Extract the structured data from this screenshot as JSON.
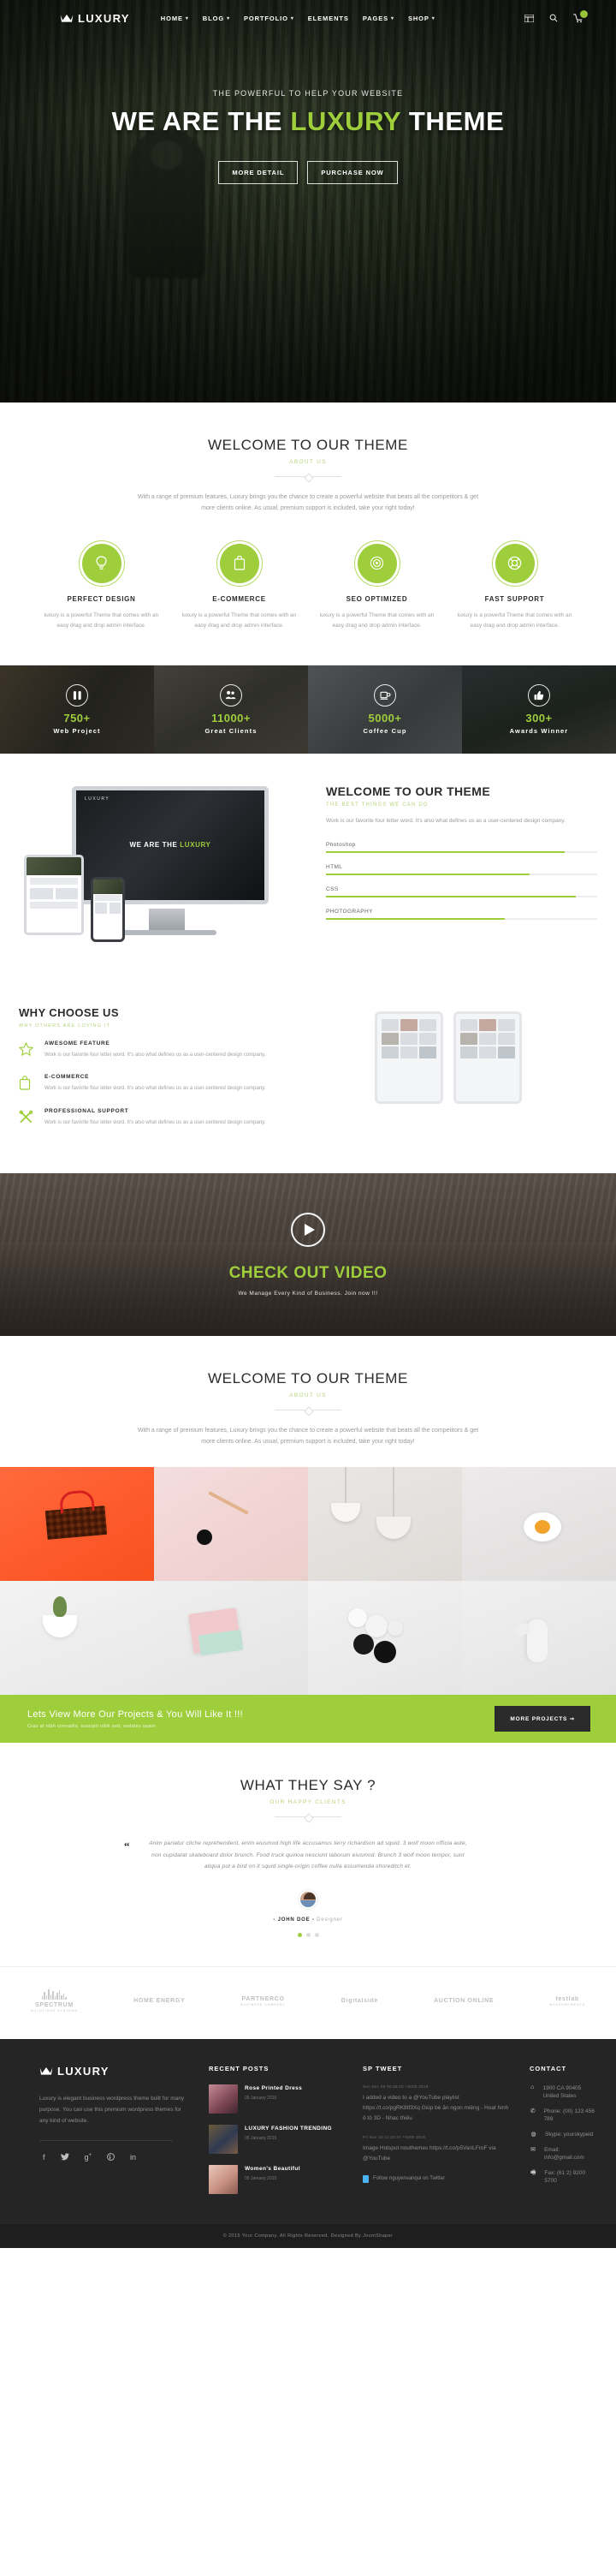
{
  "header": {
    "brand": "LUXURY",
    "nav": [
      {
        "label": "HOME",
        "caret": true
      },
      {
        "label": "BLOG",
        "caret": true
      },
      {
        "label": "PORTFOLIO",
        "caret": true
      },
      {
        "label": "ELEMENTS",
        "caret": false
      },
      {
        "label": "PAGES",
        "caret": true
      },
      {
        "label": "SHOP",
        "caret": true
      }
    ],
    "icons": [
      "grid-icon",
      "search-icon",
      "cart-icon"
    ]
  },
  "hero": {
    "kicker": "THE POWERFUL TO HELP YOUR WEBSITE",
    "title_pre": "WE ARE THE ",
    "title_accent": "LUXURY",
    "title_post": " THEME",
    "btn_primary": "MORE DETAIL",
    "btn_secondary": "PURCHASE NOW"
  },
  "welcome": {
    "title": "WELCOME TO OUR THEME",
    "subtitle": "ABOUT US",
    "description": "With a range of premium features, Luxury brings you the chance to create a powerful website that beats all the competitors & get more clients online. As usual, premium support is included, take your right today!"
  },
  "features": [
    {
      "icon": "lightbulb-icon",
      "title": "PERFECT DESIGN",
      "desc": "luxury is a powerful Theme that comes with an easy drag and drop admin interface."
    },
    {
      "icon": "bag-icon",
      "title": "E-COMMERCE",
      "desc": "luxury is a powerful Theme that comes with an easy drag and drop admin interface."
    },
    {
      "icon": "target-icon",
      "title": "SEO OPTIMIZED",
      "desc": "luxury is a powerful Theme that comes with an easy drag and drop admin interface."
    },
    {
      "icon": "lifebuoy-icon",
      "title": "FAST SUPPORT",
      "desc": "luxury is a powerful Theme that comes with an easy drag and drop admin interface."
    }
  ],
  "counters": [
    {
      "icon": "pen-icon",
      "number": "750+",
      "label": "Web Project"
    },
    {
      "icon": "users-icon",
      "number": "11000+",
      "label": "Great Clients"
    },
    {
      "icon": "coffee-icon",
      "number": "5000+",
      "label": "Coffee Cup"
    },
    {
      "icon": "thumbs-up-icon",
      "number": "300+",
      "label": "Awards Winner"
    }
  ],
  "showcase": {
    "monitor_brand": "LUXURY",
    "monitor_line_pre": "WE ARE THE ",
    "monitor_line_accent": "LUXURY",
    "title": "WELCOME TO OUR THEME",
    "subtitle": "THE BEST THINGS WE CAN DO",
    "description": "Work is our favorite four letter word. It's also what defines us as a user-centered design company.",
    "skills": [
      {
        "name": "Photoshop",
        "value": 88
      },
      {
        "name": "HTML",
        "value": 75
      },
      {
        "name": "CSS",
        "value": 92
      },
      {
        "name": "PHOTOGRAPHY",
        "value": 66
      }
    ]
  },
  "why": {
    "title": "WHY CHOOSE US",
    "subtitle": "WHY OTHERS ARE LOVING IT",
    "items": [
      {
        "icon": "star-icon",
        "title": "AWESOME FEATURE",
        "desc": "Work is our favorite four letter word. It's also what defines us as a user-centered design company."
      },
      {
        "icon": "bag-icon",
        "title": "E-COMMERCE",
        "desc": "Work is our favorite four letter word. It's also what defines us as a user-centered design company."
      },
      {
        "icon": "tools-icon",
        "title": "PROFESSIONAL SUPPORT",
        "desc": "Work is our favorite four letter word. It's also what defines us as a user-centered design company."
      }
    ]
  },
  "video": {
    "play_icon": "play-icon",
    "title": "CHECK OUT VIDEO",
    "subtitle": "We Manage Every Kind of Business. Join now !!!"
  },
  "portfolio": {
    "title": "WELCOME TO OUR THEME",
    "subtitle": "ABOUT US",
    "description": "With a range of premium features, Luxury brings you the chance to create a powerful website that beats all the competitors & get more clients online. As usual, premium support is included, take your right today!",
    "cta_title": "Lets View More Our Projects & You Will Like It !!!",
    "cta_sub": "Cras at nibh convallis, suscipit nibh sed, sodales quam",
    "cta_button": "MORE PROJECTS ➞"
  },
  "testimonial": {
    "title": "WHAT THEY SAY ?",
    "subtitle": "OUR HAPPY CLIENTS",
    "quote_mark": "“",
    "quote": "Anim pariatur cliche reprehenderit, enim eiusmod high life accusamus terry richardson ad squid. 3 wolf moon officia aute, non cupidatat skateboard dolor brunch. Food truck quinoa nesciunt laborum eiusmod. Brunch 3 wolf moon tempor, sunt aliqua put a bird on it squid single-origin coffee nulla assumenda shoreditch et.",
    "author": "- JOHN DOE -",
    "role": "Designer",
    "dots": 3,
    "active_dot": 0
  },
  "clients": [
    {
      "name": "SPECTRUM",
      "tag": "SOLUTIONS SYSTEMS"
    },
    {
      "name": "HOME ENERGY",
      "tag": ""
    },
    {
      "name": "PARTNERCO",
      "tag": "BUSINESS COMPANY"
    },
    {
      "name": "Digitalside",
      "tag": ""
    },
    {
      "name": "AUCTION ONLINE",
      "tag": ""
    },
    {
      "name": "testlab",
      "tag": "MEASUREMENTS"
    }
  ],
  "footer": {
    "brand": "LUXURY",
    "description": "Luxury is elegant business wordpress theme built for many purpose. You can use this premium wordpress themes for any kind of website.",
    "socials": [
      "facebook-icon",
      "twitter-icon",
      "google-plus-icon",
      "pinterest-icon",
      "linkedin-icon"
    ],
    "recent_posts_title": "RECENT POSTS",
    "posts": [
      {
        "title": "Rose Printed Dress",
        "date": "05 January 2015"
      },
      {
        "title": "LUXURY FASHION TRENDING",
        "date": "05 January 2015"
      },
      {
        "title": "Women's Beautiful",
        "date": "05 January 2015"
      }
    ],
    "tweet_title": "SP TWEET",
    "tweets": [
      {
        "date": "Sun Dec 09 00:08:10 +0000 2018",
        "text": "I added a video to a @YouTube playlist https://t.co/pgRK8tf3Xq Giúp bé ăn ngon miệng - Hoạt hình ô tô 3D - Nhạc thiếu"
      },
      {
        "date": "Fri Nov 30 11:33:37 +0000 2018",
        "text": "Image Hotspot nouthemes https://t.co/p5VanLFroF via @YouTube"
      }
    ],
    "follow": "Follow nguyenvanqui on Twitter",
    "contact_title": "CONTACT",
    "contacts": [
      {
        "icon": "home-icon",
        "text": "1900 CA 90405 United States"
      },
      {
        "icon": "phone-icon",
        "text": "Phone: (00) 123 456 789"
      },
      {
        "icon": "skype-icon",
        "text": "Skype: yourskypeid"
      },
      {
        "icon": "mail-icon",
        "text": "Email: info@gmail.com"
      },
      {
        "icon": "fax-icon",
        "text": "Fax: (61 2) 9200 5700"
      }
    ],
    "copyright": "© 2015 Your Company. All Rights Reserved. Designed By JoomShaper"
  }
}
